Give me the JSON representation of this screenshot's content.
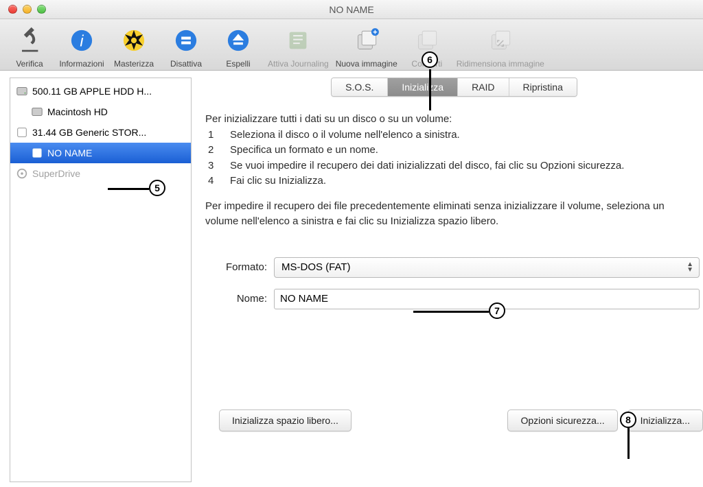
{
  "window": {
    "title": "NO NAME"
  },
  "toolbar": [
    {
      "id": "verify",
      "label": "Verifica",
      "enabled": true
    },
    {
      "id": "info",
      "label": "Informazioni",
      "enabled": true
    },
    {
      "id": "burn",
      "label": "Masterizza",
      "enabled": true
    },
    {
      "id": "unmount",
      "label": "Disattiva",
      "enabled": true
    },
    {
      "id": "eject",
      "label": "Espelli",
      "enabled": true
    },
    {
      "id": "journaling",
      "label": "Attiva Journaling",
      "enabled": false
    },
    {
      "id": "newimage",
      "label": "Nuova immagine",
      "enabled": true
    },
    {
      "id": "convert",
      "label": "Converti",
      "enabled": false
    },
    {
      "id": "resize",
      "label": "Ridimensiona immagine",
      "enabled": false
    }
  ],
  "sidebar": {
    "items": [
      {
        "label": "500.11 GB APPLE HDD H...",
        "level": 0,
        "kind": "disk"
      },
      {
        "label": "Macintosh HD",
        "level": 1,
        "kind": "volume"
      },
      {
        "label": "31.44 GB Generic STOR...",
        "level": 0,
        "kind": "external"
      },
      {
        "label": "NO NAME",
        "level": 1,
        "kind": "volume",
        "selected": true
      },
      {
        "label": "SuperDrive",
        "level": 0,
        "kind": "optical",
        "disabled": true
      }
    ]
  },
  "tabs": [
    {
      "label": "S.O.S."
    },
    {
      "label": "Inizializza",
      "active": true
    },
    {
      "label": "RAID"
    },
    {
      "label": "Ripristina"
    }
  ],
  "instructions": {
    "intro": "Per inizializzare tutti i dati su un disco o su un volume:",
    "steps": [
      "Seleziona il disco o il volume nell'elenco a sinistra.",
      "Specifica un formato e un nome.",
      "Se vuoi impedire il recupero dei dati inizializzati del disco, fai clic su Opzioni sicurezza.",
      "Fai clic su Inizializza."
    ],
    "note": "Per impedire il recupero dei file precedentemente eliminati senza inizializzare il volume, seleziona un volume nell'elenco a sinistra e fai clic su Inizializza spazio libero."
  },
  "form": {
    "format_label": "Formato:",
    "format_value": "MS-DOS (FAT)",
    "name_label": "Nome:",
    "name_value": "NO NAME"
  },
  "buttons": {
    "erase_free": "Inizializza spazio libero...",
    "security": "Opzioni sicurezza...",
    "erase": "Inizializza..."
  },
  "annotations": {
    "5": "5",
    "6": "6",
    "7": "7",
    "8": "8"
  }
}
